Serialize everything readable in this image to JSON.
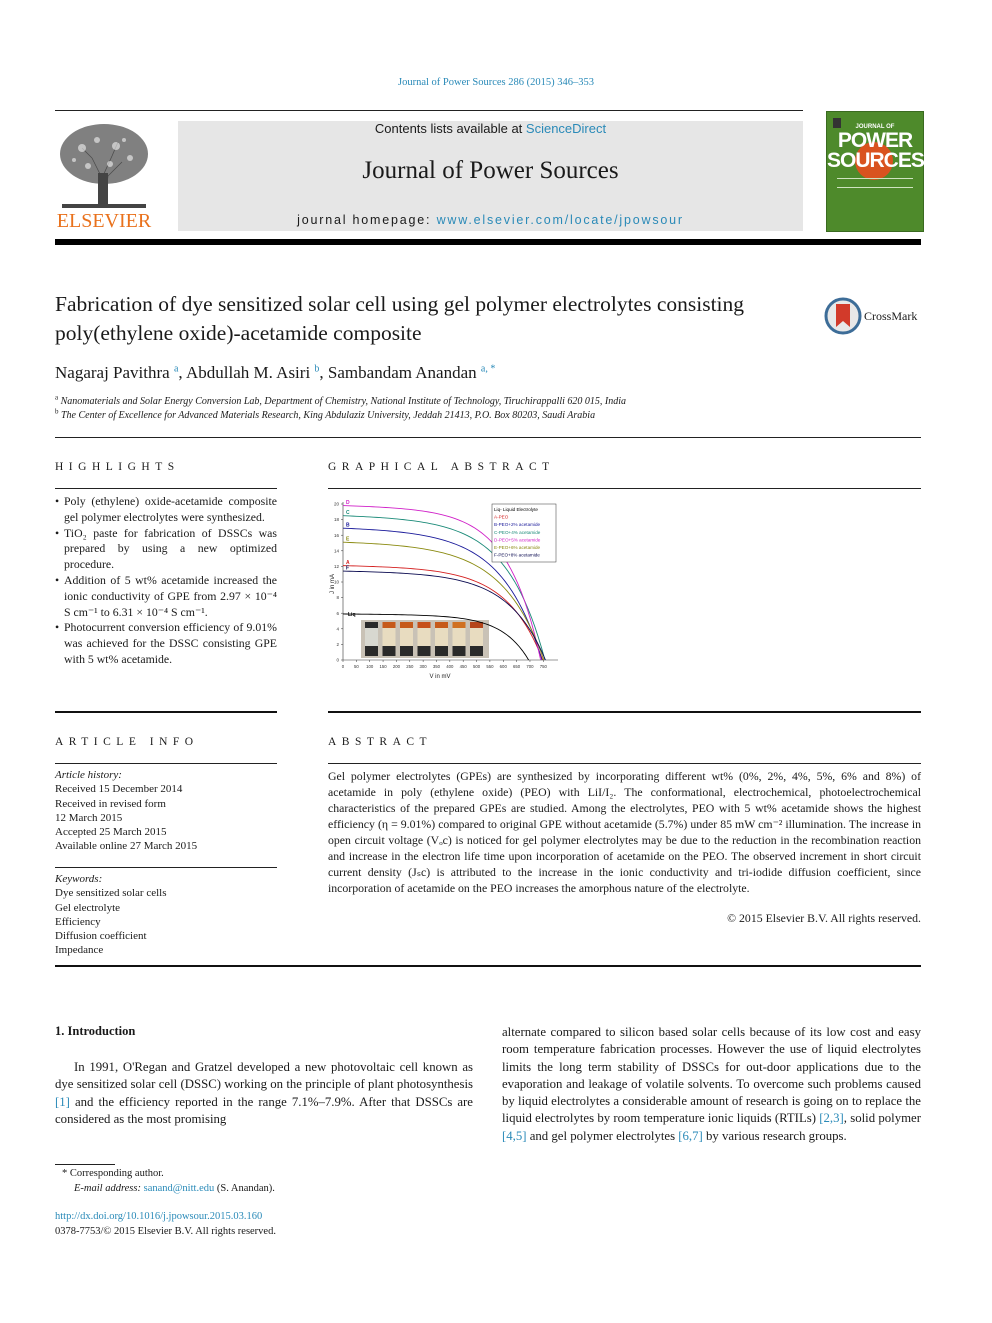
{
  "running_head": "Journal of Power Sources 286 (2015) 346–353",
  "masthead": {
    "publisher_logo_label": "ELSEVIER",
    "contents_prefix": "Contents lists available at ",
    "contents_link": "ScienceDirect",
    "journal_name": "Journal of Power Sources",
    "homepage_prefix": "journal homepage: ",
    "homepage_link": "www.elsevier.com/locate/jpowsour",
    "cover": {
      "top_line": "JOURNAL OF",
      "title": "POWER SOURCES",
      "bg_color": "#4e8a2b",
      "sun_color": "#d9531f"
    },
    "publisher_color": "#e9711c",
    "link_color": "#2a8ab8"
  },
  "article": {
    "title": "Fabrication of dye sensitized solar cell using gel polymer electrolytes consisting poly(ethylene oxide)-acetamide composite",
    "crossmark_label": "CrossMark",
    "authors": [
      {
        "name": "Nagaraj Pavithra",
        "sup": "a"
      },
      {
        "name": "Abdullah M. Asiri",
        "sup": "b"
      },
      {
        "name": "Sambandam Anandan",
        "sup": "a, *"
      }
    ],
    "affiliations": [
      {
        "sup": "a",
        "text": "Nanomaterials and Solar Energy Conversion Lab, Department of Chemistry, National Institute of Technology, Tiruchirappalli 620 015, India"
      },
      {
        "sup": "b",
        "text": "The Center of Excellence for Advanced Materials Research, King Abdulaziz University, Jeddah 21413, P.O. Box 80203, Saudi Arabia"
      }
    ]
  },
  "highlights": {
    "heading": "HIGHLIGHTS",
    "items": [
      "Poly (ethylene) oxide-acetamide composite gel polymer electrolytes were synthesized.",
      "TiO₂ paste for fabrication of DSSCs was prepared by using a new optimized procedure.",
      "Addition of 5 wt% acetamide increased the ionic conductivity of GPE from 2.97 × 10⁻⁴ S cm⁻¹ to 6.31 × 10⁻⁴ S cm⁻¹.",
      "Photocurrent conversion efficiency of 9.01% was achieved for the DSSC consisting GPE with 5 wt% acetamide."
    ]
  },
  "graphical_abstract": {
    "heading": "GRAPHICAL ABSTRACT",
    "inset_label": "Liq"
  },
  "article_info": {
    "heading": "ARTICLE INFO",
    "history_label": "Article history:",
    "history": [
      "Received 15 December 2014",
      "Received in revised form",
      "12 March 2015",
      "Accepted 25 March 2015",
      "Available online 27 March 2015"
    ],
    "keywords_label": "Keywords:",
    "keywords": [
      "Dye sensitized solar cells",
      "Gel electrolyte",
      "Efficiency",
      "Diffusion coefficient",
      "Impedance"
    ]
  },
  "abstract": {
    "heading": "ABSTRACT",
    "text": "Gel polymer electrolytes (GPEs) are synthesized by incorporating different wt% (0%, 2%, 4%, 5%, 6% and 8%) of acetamide in poly (ethylene oxide) (PEO) with LiI/I₂. The conformational, electrochemical, photoelectrochemical characteristics of the prepared GPEs are studied. Among the electrolytes, PEO with 5 wt% acetamide shows the highest efficiency (η = 9.01%) compared to original GPE without acetamide (5.7%) under 85 mW cm⁻² illumination. The increase in open circuit voltage (Vₒc) is noticed for gel polymer electrolytes may be due to the reduction in the recombination reaction and increase in the electron life time upon incorporation of acetamide on the PEO. The observed increment in short circuit current density (Jₛc) is attributed to the increase in the ionic conductivity and tri-iodide diffusion coefficient, since incorporation of acetamide on the PEO increases the amorphous nature of the electrolyte.",
    "copyright": "© 2015 Elsevier B.V. All rights reserved."
  },
  "introduction": {
    "heading": "1.  Introduction",
    "p1_parts": [
      "In 1991, O'Regan and Gratzel developed a new photovoltaic cell known as dye sensitized solar cell (DSSC) working on the principle of plant photosynthesis ",
      "[1]",
      " and the efficiency reported in the range 7.1%–7.9%. After that DSSCs are considered as the most promising"
    ],
    "p2_parts": [
      "alternate compared to silicon based solar cells because of its low cost and easy room temperature fabrication processes. However the use of liquid electrolytes limits the long term stability of DSSCs for out-door applications due to the evaporation and leakage of volatile solvents. To overcome such problems caused by liquid electrolytes a considerable amount of research is going on to replace the liquid electrolytes by room temperature ionic liquids (RTILs) ",
      "[2,3]",
      ", solid polymer ",
      "[4,5]",
      " and gel polymer electrolytes ",
      "[6,7]",
      " by various research groups."
    ]
  },
  "footnote": {
    "corresponding": "*  Corresponding author.",
    "email_label": "E-mail address: ",
    "email": "sanand@nitt.edu",
    "email_suffix": " (S. Anandan).",
    "doi": "http://dx.doi.org/10.1016/j.jpowsour.2015.03.160",
    "issn": "0378-7753/© 2015 Elsevier B.V. All rights reserved."
  },
  "chart_data": {
    "type": "line",
    "title": "",
    "xlabel": "V in mV",
    "ylabel": "J in mA",
    "xlim": [
      0,
      775
    ],
    "ylim": [
      0,
      20
    ],
    "xticks": [
      0,
      50,
      100,
      150,
      200,
      250,
      300,
      350,
      400,
      450,
      500,
      550,
      600,
      650,
      700,
      750
    ],
    "yticks": [
      0,
      2,
      4,
      6,
      8,
      10,
      12,
      14,
      16,
      18,
      20
    ],
    "legend_position": "top-right",
    "legend": [
      "Liq- Liquid Electrolyte",
      "A-PEO",
      "B-PEO+2% acetamide",
      "C-PEO+4% acetamide",
      "D-PEO+5% acetamide",
      "E-PEO+6% acetamide",
      "F-PEO+8% acetamide"
    ],
    "series": [
      {
        "name": "Liq",
        "label": "Liq",
        "color": "#000000",
        "jsc": 5.9,
        "voc": 695,
        "knee": 0.78
      },
      {
        "name": "A-PEO",
        "label": "A",
        "color": "#d42020",
        "jsc": 12.1,
        "voc": 748,
        "knee": 0.62
      },
      {
        "name": "B-PEO+2% acetamide",
        "label": "B",
        "color": "#1a1a9a",
        "jsc": 16.9,
        "voc": 745,
        "knee": 0.56
      },
      {
        "name": "C-PEO+4% acetamide",
        "label": "C",
        "color": "#1a8a78",
        "jsc": 18.5,
        "voc": 756,
        "knee": 0.6
      },
      {
        "name": "D-PEO+5% acetamide",
        "label": "D",
        "color": "#d020c8",
        "jsc": 19.8,
        "voc": 740,
        "knee": 0.68
      },
      {
        "name": "E-PEO+6% acetamide",
        "label": "E",
        "color": "#8a8a10",
        "jsc": 15.1,
        "voc": 752,
        "knee": 0.55
      },
      {
        "name": "F-PEO+8% acetamide",
        "label": "F",
        "color": "#0a0a50",
        "jsc": 11.4,
        "voc": 758,
        "knee": 0.62
      }
    ]
  }
}
